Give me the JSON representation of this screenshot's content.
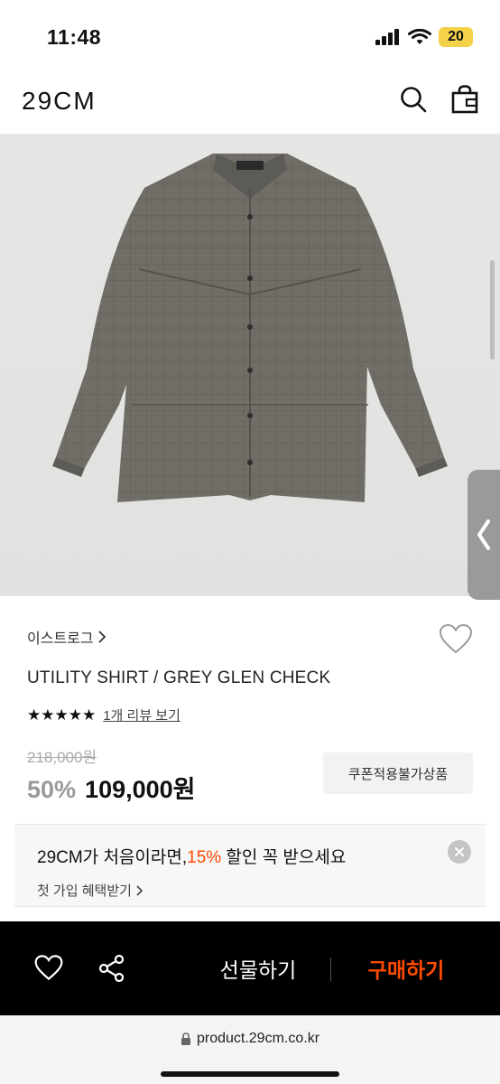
{
  "status_bar": {
    "time": "11:48",
    "battery": "20"
  },
  "header": {
    "logo": "29CM",
    "search_icon": "search-icon",
    "bag_icon": "shopping-bag-icon"
  },
  "product": {
    "brand": "이스트로그",
    "name": "UTILITY SHIRT / GREY GLEN CHECK",
    "rating_stars": "★★★★★",
    "review_link": "1개 리뷰 보기",
    "original_price": "218,000원",
    "discount": "50%",
    "sale_price": "109,000원",
    "coupon_badge": "쿠폰적용불가상품"
  },
  "promo": {
    "text_before": "29CM가 처음이라면,",
    "text_accent": "15%",
    "text_after": " 할인 꼭 받으세요",
    "link": "첫 가입 혜택받기",
    "accent_color": "#ff4800"
  },
  "bottom_bar": {
    "gift_label": "선물하기",
    "buy_label": "구매하기",
    "buy_color": "#ff4b00"
  },
  "browser": {
    "url": "product.29cm.co.kr"
  }
}
